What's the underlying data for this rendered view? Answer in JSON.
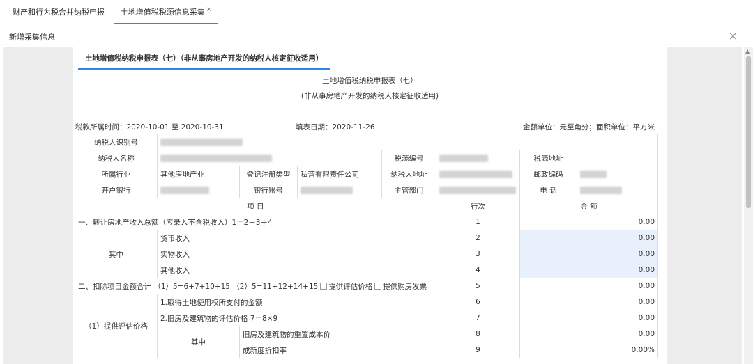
{
  "tabs": [
    {
      "label": "财产和行为税合并纳税申报"
    },
    {
      "label": "土地增值税税源信息采集",
      "close": "×"
    }
  ],
  "dialog": {
    "title": "新增采集信息",
    "close": "×"
  },
  "subtab": {
    "label": "土地增值税纳税申报表（七）（非从事房地产开发的纳税人核定征收适用）"
  },
  "form": {
    "title": "土地增值税纳税申报表（七）",
    "subtitle": "(非从事房地产开发的纳税人核定征收适用)",
    "period": "税款所属时间：2020-10-01 至 2020-10-31",
    "fill_date": "填表日期：2020-11-26",
    "unit": "金额单位：元至角分；面积单位：平方米"
  },
  "info": {
    "taxpayer_id": "纳税人识别号",
    "taxpayer_name": "纳税人名称",
    "source_no": "税源编号",
    "source_addr": "税源地址",
    "industry": "所属行业",
    "industry_val": "其他房地产业",
    "reg_type": "登记注册类型",
    "reg_type_val": "私营有限责任公司",
    "taxpayer_addr": "纳税人地址",
    "postcode": "邮政编码",
    "bank": "开户银行",
    "account": "银行账号",
    "dept": "主管部门",
    "phone": "电 话"
  },
  "header": {
    "item": "项 目",
    "row": "行次",
    "amount": "金 额"
  },
  "rows": [
    {
      "label": "一、转让房地产收入总额（应录入不含税收入）1＝2＋3＋4",
      "no": "1",
      "amount": "0.00"
    },
    {
      "group": "其中",
      "label": "货币收入",
      "no": "2",
      "amount": "0.00"
    },
    {
      "label": "实物收入",
      "no": "3",
      "amount": "0.00"
    },
    {
      "label": "其他收入",
      "no": "4",
      "amount": "0.00"
    },
    {
      "label": "二、扣除项目金额合计 （1）5=6+7+10+15 （2）5=11+12+14+15",
      "opt1": "提供评估价格",
      "opt2": "提供购房发票",
      "no": "5",
      "amount": "0.00"
    },
    {
      "group": "（1）提供评估价格",
      "label": "1.取得土地使用权所支付的金额",
      "no": "6",
      "amount": "0.00"
    },
    {
      "label": "2.旧房及建筑物的评估价格 7＝8×9",
      "no": "7",
      "amount": "0.00"
    },
    {
      "sub": "其中",
      "label": "旧房及建筑物的重置成本价",
      "no": "8",
      "amount": "0.00"
    },
    {
      "label": "成新度折扣率",
      "no": "9",
      "amount": "0.00%"
    }
  ]
}
